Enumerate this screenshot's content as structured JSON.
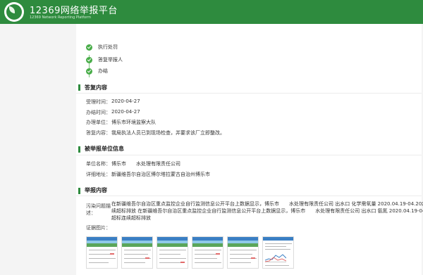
{
  "header": {
    "title": "12369网络举报平台",
    "subtitle": "12369 Network Reporting Platform"
  },
  "steps": [
    {
      "label": "执行处罚"
    },
    {
      "label": "答复举报人"
    },
    {
      "label": "办结"
    }
  ],
  "reply_section": {
    "title": "答复内容",
    "rows": [
      {
        "label": "受理时间：",
        "value": "2020-04-27"
      },
      {
        "label": "办结时间：",
        "value": "2020-04-27"
      },
      {
        "label": "办理单位：",
        "value": "博乐市环境监察大队"
      },
      {
        "label": "答复内容：",
        "value": "我局执法人员已到现场检查，并要求该厂立即整改。"
      }
    ]
  },
  "reported_section": {
    "title": "被举报单位信息",
    "rows": [
      {
        "label": "单位名称：",
        "value": "博乐市　　水处理有限责任公司"
      },
      {
        "label": "详细地址：",
        "value": "新疆维吾尔自治区博尔塔拉蒙古自治州博乐市"
      }
    ]
  },
  "report_section": {
    "title": "举报内容",
    "problem_label_1": "污染问题描",
    "problem_label_2": "述：",
    "problem_lines": [
      "在新疆维吾尔自治区重点监控企业自行监测信息公开平台上数据显示，博乐市　　水处理有限责任公司 出水口 化学需氧量 2020.04.19-04.20超标连",
      "续超标排放 在新疆维吾尔自治区重点监控企业自行监测信息公开平台上数据显示，博乐市　　水处理有限责任公司 出水口 氨氮 2020.04.19-04.20",
      "超标连续超标排放"
    ],
    "evidence_label": "证据图片："
  },
  "colors": {
    "brand": "#2e8b3e",
    "step_check": "#49ad49"
  },
  "icons": [
    "logo-icon",
    "check-circle-icon"
  ]
}
